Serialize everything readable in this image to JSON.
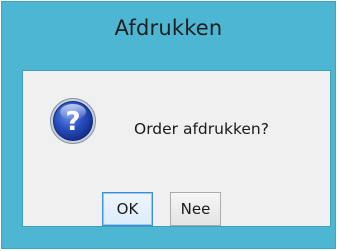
{
  "window": {
    "title": "Afdrukken"
  },
  "dialog": {
    "icon": "question-icon",
    "message": "Order afdrukken?",
    "buttons": {
      "ok_label": "OK",
      "no_label": "Nee"
    }
  },
  "colors": {
    "frame": "#4db6d3",
    "client_bg": "#f0f0f0",
    "default_button_border": "#3c8ddb"
  }
}
